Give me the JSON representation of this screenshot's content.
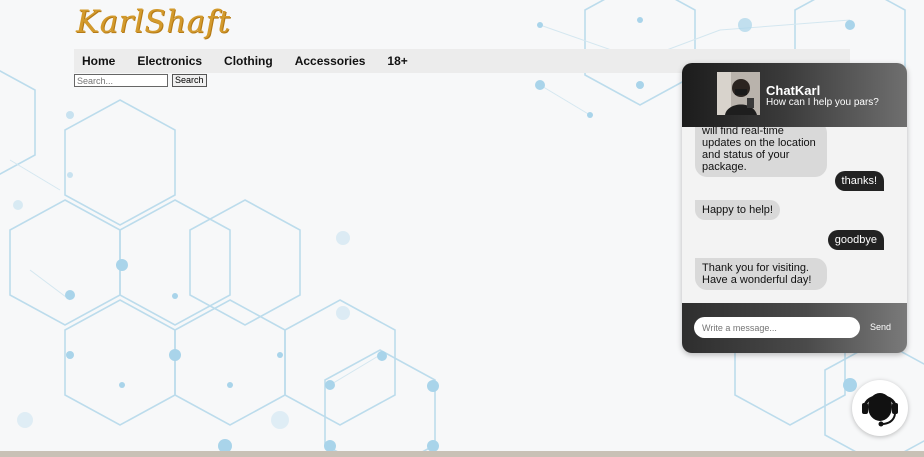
{
  "brand": {
    "logo": "KarlShaft"
  },
  "nav": {
    "items": [
      "Home",
      "Electronics",
      "Clothing",
      "Accessories",
      "18+"
    ]
  },
  "search": {
    "placeholder": "Search...",
    "button": "Search"
  },
  "chat": {
    "name": "ChatKarl",
    "subtitle": "How can I help you pars?",
    "messages": [
      {
        "from": "bot",
        "text": "will find real-time updates on the location and status of your package."
      },
      {
        "from": "user",
        "text": "thanks!"
      },
      {
        "from": "bot",
        "text": "Happy to help!"
      },
      {
        "from": "user",
        "text": "goodbye"
      },
      {
        "from": "bot",
        "text": "Thank you for visiting. Have a wonderful day!"
      }
    ],
    "input_placeholder": "Write a message...",
    "send_label": "Send"
  },
  "colors": {
    "logo": "#d39a2c",
    "chat_header": "#2a2a2a",
    "user_bubble": "#222222",
    "bot_bubble": "#d9d9d9"
  },
  "icons": {
    "support": "headset-icon",
    "avatar": "avatar-icon"
  }
}
